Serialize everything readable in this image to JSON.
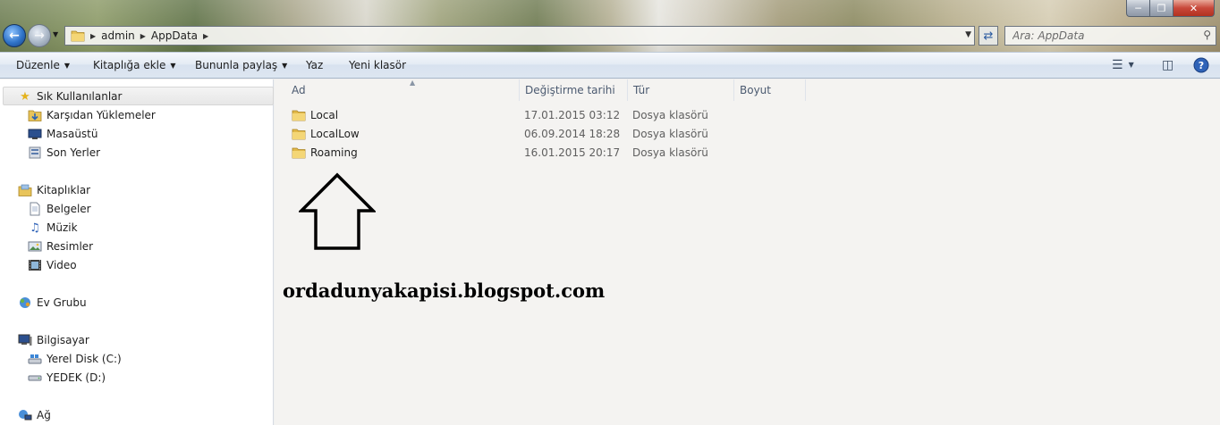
{
  "address": {
    "crumbs": [
      "admin",
      "AppData"
    ]
  },
  "search": {
    "placeholder": "Ara: AppData"
  },
  "toolbar": {
    "organize": "Düzenle",
    "add_library": "Kitaplığa ekle",
    "share": "Bununla paylaş",
    "burn": "Yaz",
    "new_folder": "Yeni klasör"
  },
  "sidebar": {
    "favorites": "Sık Kullanılanlar",
    "downloads": "Karşıdan Yüklemeler",
    "desktop": "Masaüstü",
    "recent": "Son Yerler",
    "libraries": "Kitaplıklar",
    "documents": "Belgeler",
    "music": "Müzik",
    "pictures": "Resimler",
    "video": "Video",
    "homegroup": "Ev Grubu",
    "computer": "Bilgisayar",
    "disk_c": "Yerel Disk (C:)",
    "disk_d": "YEDEK (D:)",
    "network": "Ağ"
  },
  "columns": {
    "name": "Ad",
    "modified": "Değiştirme tarihi",
    "type": "Tür",
    "size": "Boyut"
  },
  "files": [
    {
      "name": "Local",
      "modified": "17.01.2015 03:12",
      "type": "Dosya klasörü"
    },
    {
      "name": "LocalLow",
      "modified": "06.09.2014 18:28",
      "type": "Dosya klasörü"
    },
    {
      "name": "Roaming",
      "modified": "16.01.2015 20:17",
      "type": "Dosya klasörü"
    }
  ],
  "watermark": "ordadunyakapisi.blogspot.com",
  "colors": {
    "selection": "#e7e7e7",
    "accent": "#2f73c8",
    "folder": "#e8c45a"
  }
}
